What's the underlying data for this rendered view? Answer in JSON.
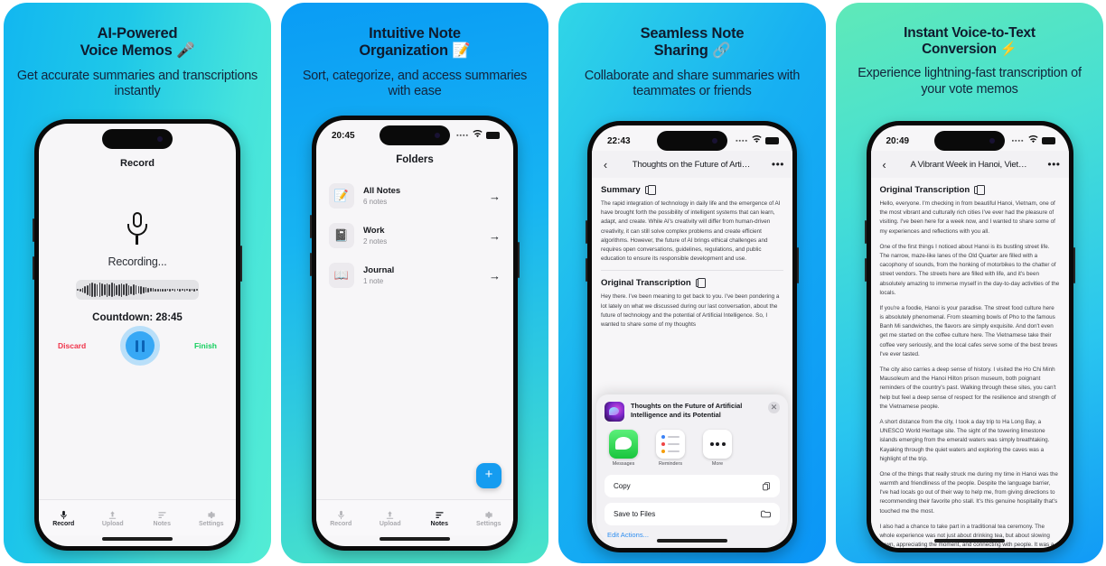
{
  "panels": [
    {
      "title": "AI-Powered\nVoice Memos 🎤",
      "title_line1": "AI-Powered",
      "title_line2": "Voice Memos 🎤",
      "subtitle": "Get accurate summaries and transcriptions instantly",
      "gradient_from": "#12b7f0",
      "gradient_to": "#53ecd4",
      "screen": {
        "kind": "record",
        "status_time": "",
        "header": "Record",
        "mic_icon": "microphone-icon",
        "recording_label": "Recording...",
        "countdown": "Countdown: 28:45",
        "discard_label": "Discard",
        "discard_color": "#f0334a",
        "finish_label": "Finish",
        "finish_color": "#14cf5e",
        "pause_icon": "pause-icon",
        "tabs": [
          {
            "label": "Record",
            "icon": "microphone-icon",
            "active": true
          },
          {
            "label": "Upload",
            "icon": "upload-icon",
            "active": false
          },
          {
            "label": "Notes",
            "icon": "notes-lines-icon",
            "active": false
          },
          {
            "label": "Settings",
            "icon": "gear-icon",
            "active": false
          }
        ]
      }
    },
    {
      "title_line1": "Intuitive Note",
      "title_line2": "Organization 📝",
      "subtitle": "Sort, categorize, and access summaries with ease",
      "gradient_from": "#0a9cf5",
      "gradient_to": "#4ae4c9",
      "screen": {
        "kind": "folders",
        "status_time": "20:45",
        "header": "Folders",
        "add_button": "+",
        "folders": [
          {
            "icon": "📝",
            "name": "All Notes",
            "count": "6 notes"
          },
          {
            "icon": "📓",
            "name": "Work",
            "count": "2 notes"
          },
          {
            "icon": "📖",
            "name": "Journal",
            "count": "1 note"
          }
        ],
        "tabs": [
          {
            "label": "Record",
            "icon": "microphone-icon",
            "active": false
          },
          {
            "label": "Upload",
            "icon": "upload-icon",
            "active": false
          },
          {
            "label": "Notes",
            "icon": "notes-lines-icon",
            "active": true
          },
          {
            "label": "Settings",
            "icon": "gear-icon",
            "active": false
          }
        ]
      }
    },
    {
      "title_line1": "Seamless Note",
      "title_line2": "Sharing 🔗",
      "subtitle": "Collaborate and share summaries with teammates or friends",
      "gradient_from": "#31d6e6",
      "gradient_to": "#0b95f7",
      "screen": {
        "kind": "note-share",
        "status_time": "22:43",
        "nav_title": "Thoughts on the Future of Arti…",
        "back_icon": "chevron-left-icon",
        "more_icon": "ellipsis-icon",
        "summary_heading": "Summary",
        "summary_text": "The rapid integration of technology in daily life and the emergence of AI have brought forth the possibility of intelligent systems that can learn, adapt, and create. While AI's creativity will differ from human-driven creativity, it can still solve complex problems and create efficient algorithms. However, the future of AI brings ethical challenges and requires open conversations, guidelines, regulations, and public education to ensure its responsible development and use.",
        "transcription_heading": "Original Transcription",
        "transcription_text": "Hey there. I've been meaning to get back to you. I've been pondering a lot lately on what we discussed during our last conversation, about the future of technology and the potential of Artificial Intelligence. So, I wanted to share some of my thoughts",
        "share_sheet": {
          "title": "Thoughts on the Future of Artificial Intelligence and its Potential",
          "close_icon": "close-icon",
          "apps": [
            {
              "label": "Messages",
              "icon": "messages-icon"
            },
            {
              "label": "Reminders",
              "icon": "reminders-icon"
            },
            {
              "label": "More",
              "icon": "more-icon"
            }
          ],
          "actions": [
            {
              "label": "Copy",
              "icon": "copy-icon"
            },
            {
              "label": "Save to Files",
              "icon": "folder-icon"
            }
          ],
          "edit_actions": "Edit Actions..."
        }
      }
    },
    {
      "title_line1": "Instant Voice-to-Text",
      "title_line2": "Conversion ⚡",
      "subtitle": "Experience lightning-fast transcription of your vote memos",
      "gradient_from": "#5fe9b8",
      "gradient_to": "#119af6",
      "screen": {
        "kind": "note-detail",
        "status_time": "20:49",
        "nav_title": "A Vibrant Week in Hanoi, Viet…",
        "back_icon": "chevron-left-icon",
        "more_icon": "ellipsis-icon",
        "transcription_heading": "Original Transcription",
        "paragraphs": [
          "Hello, everyone. I'm checking in from beautiful Hanoi, Vietnam, one of the most vibrant and culturally rich cities I've ever had the pleasure of visiting. I've been here for a week now, and I wanted to share some of my experiences and reflections with you all.",
          "One of the first things I noticed about Hanoi is its bustling street life. The narrow, maze-like lanes of the Old Quarter are filled with a cacophony of sounds, from the honking of motorbikes to the chatter of street vendors. The streets here are filled with life, and it's been absolutely amazing to immerse myself in the day-to-day activities of the locals.",
          "If you're a foodie, Hanoi is your paradise. The street food culture here is absolutely phenomenal. From steaming bowls of Pho to the famous Banh Mi sandwiches, the flavors are simply exquisite. And don't even get me started on the coffee culture here. The Vietnamese take their coffee very seriously, and the local cafes serve some of the best brews I've ever tasted.",
          "The city also carries a deep sense of history. I visited the Ho Chi Minh Mausoleum and the Hanoi Hilton prison museum, both poignant reminders of the country's past. Walking through these sites, you can't help but feel a deep sense of respect for the resilience and strength of the Vietnamese people.",
          "A short distance from the city, I took a day trip to Ha Long Bay, a UNESCO World Heritage site. The sight of the towering limestone islands emerging from the emerald waters was simply breathtaking. Kayaking through the quiet waters and exploring the caves was a highlight of the trip.",
          "One of the things that really struck me during my time in Hanoi was the warmth and friendliness of the people. Despite the language barrier, I've had locals go out of their way to help me, from giving directions to recommending their favorite pho stall. It's this genuine hospitality that's touched me the most.",
          "I also had a chance to take part in a traditional tea ceremony. The whole experience was not just about drinking tea, but about slowing down, appreciating the moment, and connecting with people. It was a serene and calming experience, a sharp contrast to the bustling city outside."
        ]
      }
    }
  ]
}
